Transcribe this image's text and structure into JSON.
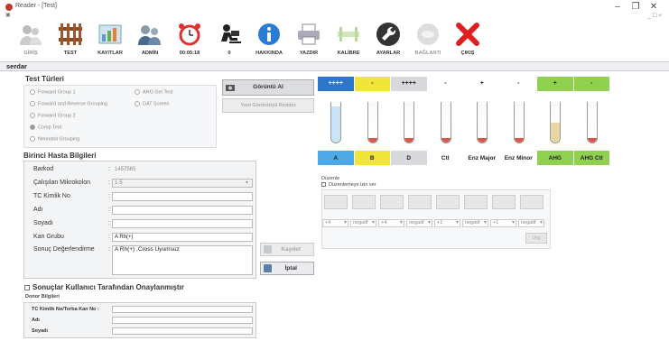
{
  "window": {
    "title": "Reader - [Test]",
    "minimize_glyph": "–",
    "maximize_glyph": "❐",
    "close_glyph": "✕",
    "inner_controls": "_ ☐ ×"
  },
  "toolbar": {
    "items": [
      {
        "label": "GİRİŞ",
        "icon": "users-icon",
        "enabled": false
      },
      {
        "label": "TEST",
        "icon": "test-rack-icon",
        "enabled": true
      },
      {
        "label": "KAYITLAR",
        "icon": "chart-records-icon",
        "enabled": true
      },
      {
        "label": "ADMİN",
        "icon": "admin-users-icon",
        "enabled": true
      },
      {
        "label": "00:05:18",
        "icon": "alarm-clock-icon",
        "enabled": true
      },
      {
        "label": "0",
        "icon": "worker-desk-icon",
        "enabled": true
      },
      {
        "label": "HAKKINDA",
        "icon": "info-icon",
        "enabled": true
      },
      {
        "label": "YAZDIR",
        "icon": "printer-icon",
        "enabled": true
      },
      {
        "label": "KALİBRE",
        "icon": "calibration-icon",
        "enabled": true
      },
      {
        "label": "AYARLAR",
        "icon": "wrench-icon",
        "enabled": true
      },
      {
        "label": "BAĞLANTI",
        "icon": "connection-icon",
        "enabled": false
      },
      {
        "label": "ÇIKIŞ",
        "icon": "exit-x-icon",
        "enabled": true
      }
    ]
  },
  "user": {
    "name": "serdar"
  },
  "test_types": {
    "title": "Test Türleri",
    "options_left": [
      {
        "label": "Forward Group 1",
        "checked": false
      },
      {
        "label": "Forward and Reverse Grouping",
        "checked": false
      },
      {
        "label": "Forward Group 2",
        "checked": false
      },
      {
        "label": "Comp Test",
        "checked": true
      },
      {
        "label": "Neonatal Grouping",
        "checked": false
      }
    ],
    "options_right": [
      {
        "label": "AHG Gel Test",
        "checked": false
      },
      {
        "label": "DAT Screen",
        "checked": false
      }
    ]
  },
  "buttons": {
    "capture_image": "Görüntü Al",
    "retake_image": "Yeni Görüntüyü Reddet",
    "save": "Kaydet",
    "cancel": "İptal",
    "apply": "Uyg"
  },
  "patient": {
    "title": "Birinci Hasta Bilgileri",
    "fields": [
      {
        "label": "Barkod",
        "value": "1457565"
      },
      {
        "label": "Çalışılan Mikrokolon",
        "value": "1-5"
      },
      {
        "label": "TC Kimlik No",
        "value": ""
      },
      {
        "label": "Adı",
        "value": ""
      },
      {
        "label": "Soyadı",
        "value": ""
      },
      {
        "label": "Kan Grubu",
        "value": "A Rh(+)"
      },
      {
        "label": "Sonuç Değerlendirme",
        "value": "A Rh(+) ,Cross Uyumsuz"
      }
    ]
  },
  "approval": {
    "label": "Sonuçlar Kullanıcı Tarafından Onaylanmıştır",
    "donor_title": "Donor Bilgileri",
    "donor_fields": [
      {
        "label": "TC Kimlik No/Torba Kan No :"
      },
      {
        "label": "Adı"
      },
      {
        "label": "Soyadı"
      }
    ]
  },
  "results": {
    "top_labels": [
      "++++",
      "-",
      "++++",
      "-",
      "+",
      "-",
      "+",
      "-"
    ],
    "top_colors": [
      "#2d77c9",
      "#f2e53a",
      "#d7d9dc",
      "#ffffff",
      "#ffffff",
      "#ffffff",
      "#8fd14f",
      "#8fd14f"
    ],
    "liquid_colors": [
      "#9fd0f0",
      "#d9574a",
      "#d9574a",
      "#d9574a",
      "#d9574a",
      "#d9574a",
      "#e7d7a0",
      "#d9574a"
    ],
    "bottom_labels": [
      "A",
      "B",
      "D",
      "Ctl",
      "Enz Major",
      "Enz Minor",
      "AHG",
      "AHG Ctl"
    ],
    "bottom_colors": [
      "#4aa9e6",
      "#f2e53a",
      "#d7d9dc",
      "#ffffff",
      "#ffffff",
      "#ffffff",
      "#8fd14f",
      "#8fd14f"
    ]
  },
  "edit": {
    "title": "Düzenle",
    "checkbox_label": "Düzenlemeye izin ver",
    "dropdown_values": [
      "+4",
      "negatif",
      "+4",
      "negatif",
      "+1",
      "negatif",
      "+1",
      "negatif"
    ]
  }
}
